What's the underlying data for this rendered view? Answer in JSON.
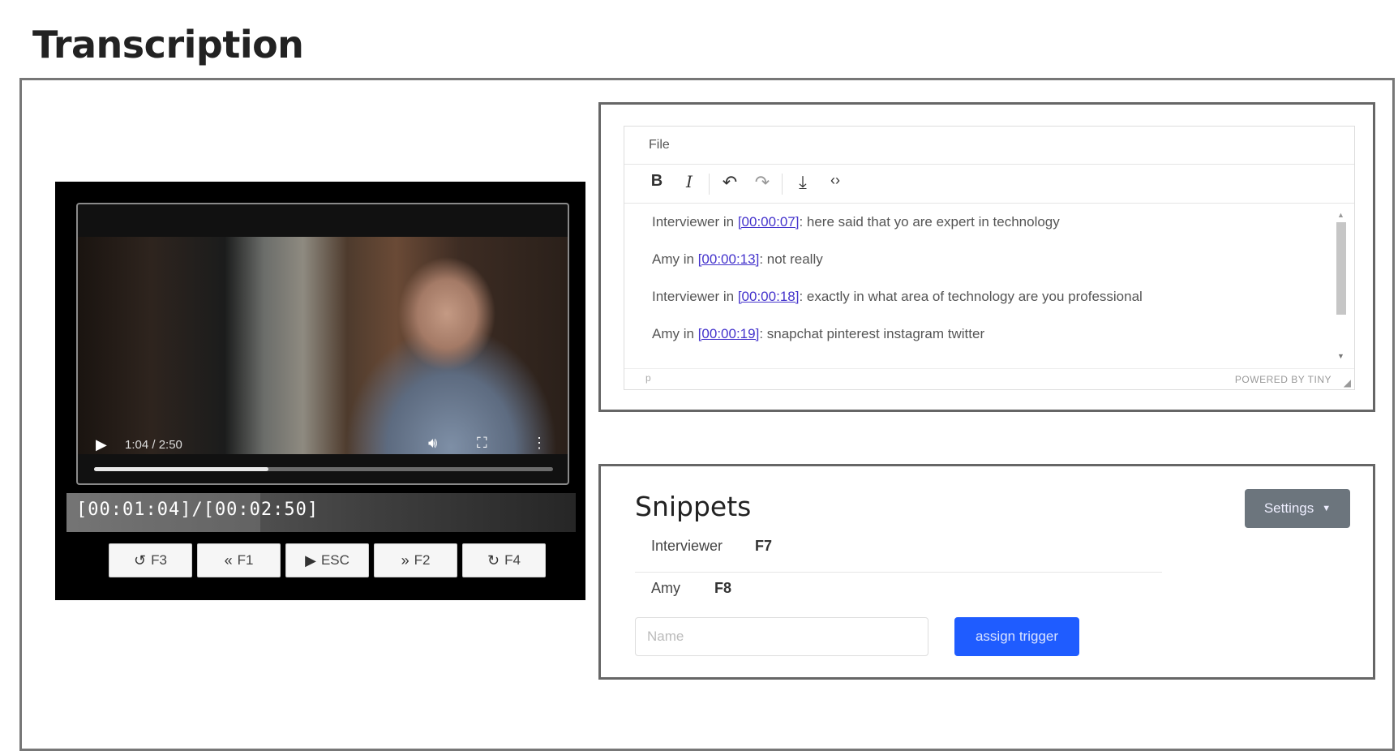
{
  "page": {
    "title": "Transcription"
  },
  "player": {
    "video_time": "1:04 / 2:50",
    "progress_fraction": 0.38,
    "timecode": "[00:01:04]/[00:02:50]",
    "controls": [
      {
        "icon": "rewind-icon",
        "glyph": "↺",
        "label": "F3"
      },
      {
        "icon": "back-icon",
        "glyph": "«",
        "label": "F1"
      },
      {
        "icon": "play-icon",
        "glyph": "▶",
        "label": "ESC"
      },
      {
        "icon": "forward-icon",
        "glyph": "»",
        "label": "F2"
      },
      {
        "icon": "restart-icon",
        "glyph": "↻",
        "label": "F4"
      }
    ]
  },
  "editor": {
    "menu_file": "File",
    "toolbar": {
      "bold": "B",
      "italic": "I",
      "undo": "↶",
      "redo": "↷",
      "download": "⤓",
      "code": "‹›"
    },
    "lines": [
      {
        "speaker": "Interviewer in ",
        "timestamp": "[00:00:07]",
        "text": ": here said that yo are expert in technology"
      },
      {
        "speaker": "Amy in ",
        "timestamp": "[00:00:13]",
        "text": ": not really"
      },
      {
        "speaker": "Interviewer in ",
        "timestamp": "[00:00:18]",
        "text": ": exactly in what area of technology are you professional"
      },
      {
        "speaker": "Amy in ",
        "timestamp": "[00:00:19]",
        "text": ": snapchat pinterest instagram twitter"
      }
    ],
    "status_path": "p",
    "powered_by": "POWERED BY TINY"
  },
  "snippets": {
    "title": "Snippets",
    "settings_label": "Settings",
    "items": [
      {
        "name": "Interviewer",
        "key": "F7"
      },
      {
        "name": "Amy",
        "key": "F8"
      }
    ],
    "name_placeholder": "Name",
    "assign_label": "assign trigger"
  }
}
